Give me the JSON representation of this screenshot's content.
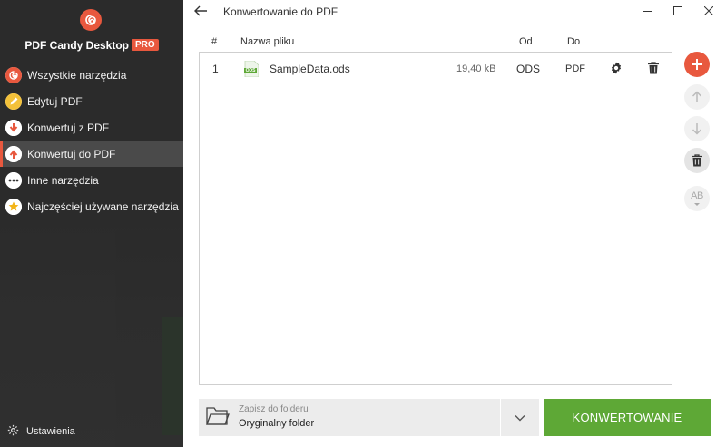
{
  "app": {
    "name": "PDF Candy Desktop",
    "badge": "PRO",
    "accent_color": "#e8583e"
  },
  "sidebar": {
    "items": [
      {
        "label": "Wszystkie narzędzia",
        "icon": "spiral-icon",
        "active": false
      },
      {
        "label": "Edytuj PDF",
        "icon": "pencil-icon",
        "active": false
      },
      {
        "label": "Konwertuj z PDF",
        "icon": "arrow-down-icon",
        "active": false
      },
      {
        "label": "Konwertuj do PDF",
        "icon": "arrow-up-icon",
        "active": true
      },
      {
        "label": "Inne narzędzia",
        "icon": "dots-icon",
        "active": false
      },
      {
        "label": "Najczęściej używane narzędzia",
        "icon": "star-icon",
        "active": false
      }
    ],
    "settings_label": "Ustawienia"
  },
  "header": {
    "title": "Konwertowanie do PDF"
  },
  "table": {
    "columns": {
      "num": "#",
      "name": "Nazwa pliku",
      "from": "Od",
      "to": "Do"
    },
    "rows": [
      {
        "num": "1",
        "name": "SampleData.ods",
        "size": "19,40 kB",
        "from": "ODS",
        "to": "PDF",
        "file_icon_text": "ODS"
      }
    ]
  },
  "side_buttons": [
    "add-icon",
    "arrow-up-icon",
    "arrow-down-icon",
    "trash-icon",
    "rename-icon"
  ],
  "side_labels": {
    "rename": "AB"
  },
  "footer": {
    "save_sub": "Zapisz do folderu",
    "save_value": "Oryginalny folder",
    "convert_label": "KONWERTOWANIE",
    "convert_color": "#5ea836"
  }
}
